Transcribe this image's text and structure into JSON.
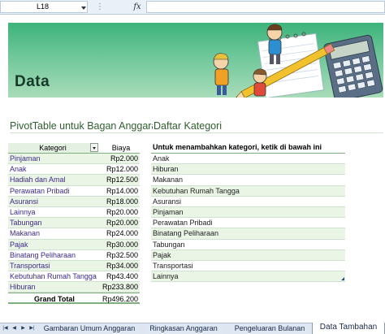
{
  "formula_bar": {
    "cell_reference": "L18",
    "fx_label": "fx",
    "formula": ""
  },
  "banner": {
    "title": "Data"
  },
  "section": {
    "pivot_title": "PivotTable untuk Bagan Anggaran",
    "category_title": "Daftar Kategori"
  },
  "pivot": {
    "header_kategori": "Kategori",
    "header_biaya": "Biaya",
    "rows": [
      {
        "kategori": "Pinjaman",
        "biaya": "Rp2.000"
      },
      {
        "kategori": "Anak",
        "biaya": "Rp12.000"
      },
      {
        "kategori": "Hadiah dan Amal",
        "biaya": "Rp12.500"
      },
      {
        "kategori": "Perawatan Pribadi",
        "biaya": "Rp14.000"
      },
      {
        "kategori": "Asuransi",
        "biaya": "Rp18.000"
      },
      {
        "kategori": "Lainnya",
        "biaya": "Rp20.000"
      },
      {
        "kategori": "Tabungan",
        "biaya": "Rp20.000"
      },
      {
        "kategori": "Makanan",
        "biaya": "Rp24.000"
      },
      {
        "kategori": "Pajak",
        "biaya": "Rp30.000"
      },
      {
        "kategori": "Binatang Peliharaan",
        "biaya": "Rp32.500"
      },
      {
        "kategori": "Transportasi",
        "biaya": "Rp34.000"
      },
      {
        "kategori": "Kebutuhan Rumah Tangga",
        "biaya": "Rp43.400"
      },
      {
        "kategori": "Hiburan",
        "biaya": "Rp233.800"
      }
    ],
    "total_label": "Grand Total",
    "total_value": "Rp496.200"
  },
  "categories": {
    "header": "Untuk menambahkan kategori, ketik di bawah ini",
    "items": [
      "Anak",
      "Hiburan",
      "Makanan",
      "Kebutuhan Rumah Tangga",
      "Asuransi",
      "Pinjaman",
      "Perawatan Pribadi",
      "Binatang Peliharaan",
      "Tabungan",
      "Pajak",
      "Transportasi",
      "Lainnya"
    ]
  },
  "tabs": {
    "nav": [
      "first-sheet",
      "previous-sheet",
      "next-sheet",
      "last-sheet"
    ],
    "sheets": [
      "Gambaran Umum Anggaran",
      "Ringkasan Anggaran",
      "Pengeluaran Bulanan",
      "Data Tambahan"
    ],
    "active": "Data Tambahan"
  },
  "colors": {
    "banner_green": "#3db37a",
    "row_band": "#eaf5e6",
    "title_green": "#2f5f2f",
    "category_text": "#3d2a8a"
  }
}
